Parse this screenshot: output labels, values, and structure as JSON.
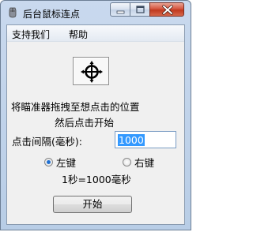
{
  "window": {
    "title": "后台鼠标连点",
    "app_icon": "mouse-icon",
    "controls": {
      "minimize_icon": "minimize-icon",
      "maximize_icon": "maximize-icon",
      "close_icon": "close-icon"
    }
  },
  "menubar": {
    "items": [
      "支持我们",
      "帮助"
    ]
  },
  "main": {
    "target_icon": "crosshair-target-icon",
    "instruction_line1": "将瞄准器拖拽至想点击的位置",
    "instruction_line2": "然后点击开始",
    "interval_label": "点击间隔(毫秒):",
    "interval_value": "1000",
    "radio_left_label": "左键",
    "radio_right_label": "右键",
    "selected_button": "左键",
    "note": "1秒=1000毫秒",
    "start_label": "开始"
  },
  "colors": {
    "accent": "#3399ff",
    "close_button": "#c0391f",
    "titlebar": "#c9d9ee"
  }
}
